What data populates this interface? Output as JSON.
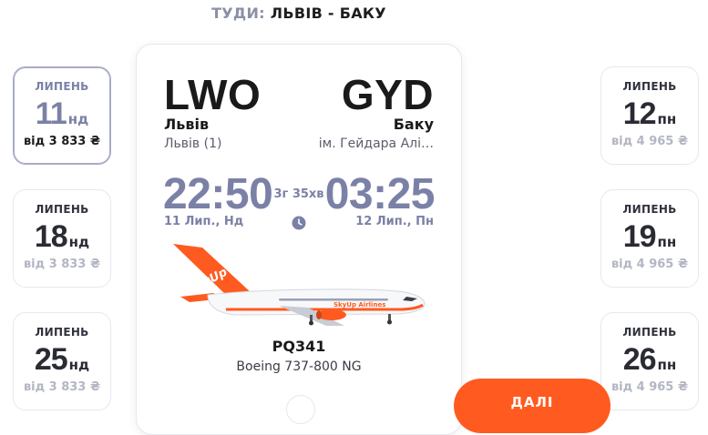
{
  "route": {
    "direction_label": "ТУДИ:",
    "cities": "ЛЬВІВ - БАКУ"
  },
  "dates_left": [
    {
      "month": "ЛИПЕНЬ",
      "day": "11",
      "dow": "нд",
      "price": "від 3 833 ₴",
      "selected": true
    },
    {
      "month": "ЛИПЕНЬ",
      "day": "18",
      "dow": "нд",
      "price": "від 3 833 ₴",
      "selected": false
    },
    {
      "month": "ЛИПЕНЬ",
      "day": "25",
      "dow": "нд",
      "price": "від 3 833 ₴",
      "selected": false
    }
  ],
  "dates_right": [
    {
      "month": "ЛИПЕНЬ",
      "day": "12",
      "dow": "пн",
      "price": "від 4 965 ₴"
    },
    {
      "month": "ЛИПЕНЬ",
      "day": "19",
      "dow": "пн",
      "price": "від 4 965 ₴"
    },
    {
      "month": "ЛИПЕНЬ",
      "day": "26",
      "dow": "пн",
      "price": "від 4 965 ₴"
    }
  ],
  "flight": {
    "origin_code": "LWO",
    "origin_city": "Львів",
    "origin_airport": "Львів (1)",
    "dest_code": "GYD",
    "dest_city": "Баку",
    "dest_airport": "ім. Гейдара Алі…",
    "depart_time": "22:50",
    "depart_date": "11 Лип., Нд",
    "arrive_time": "03:25",
    "arrive_date": "12 Лип., Пн",
    "duration": "3г 35хв",
    "number": "PQ341",
    "aircraft": "Boeing 737-800 NG",
    "airline_logo_text": "SkyUp",
    "airline_livery_text": "SkyUp Airlines"
  },
  "actions": {
    "next_label": "ДАЛІ"
  },
  "colors": {
    "accent": "#7b81a6",
    "brand_orange": "#ff5a1f",
    "muted_price": "#b3b6c3"
  },
  "icons": {
    "clock": "clock-icon",
    "airplane": "airplane-image"
  }
}
